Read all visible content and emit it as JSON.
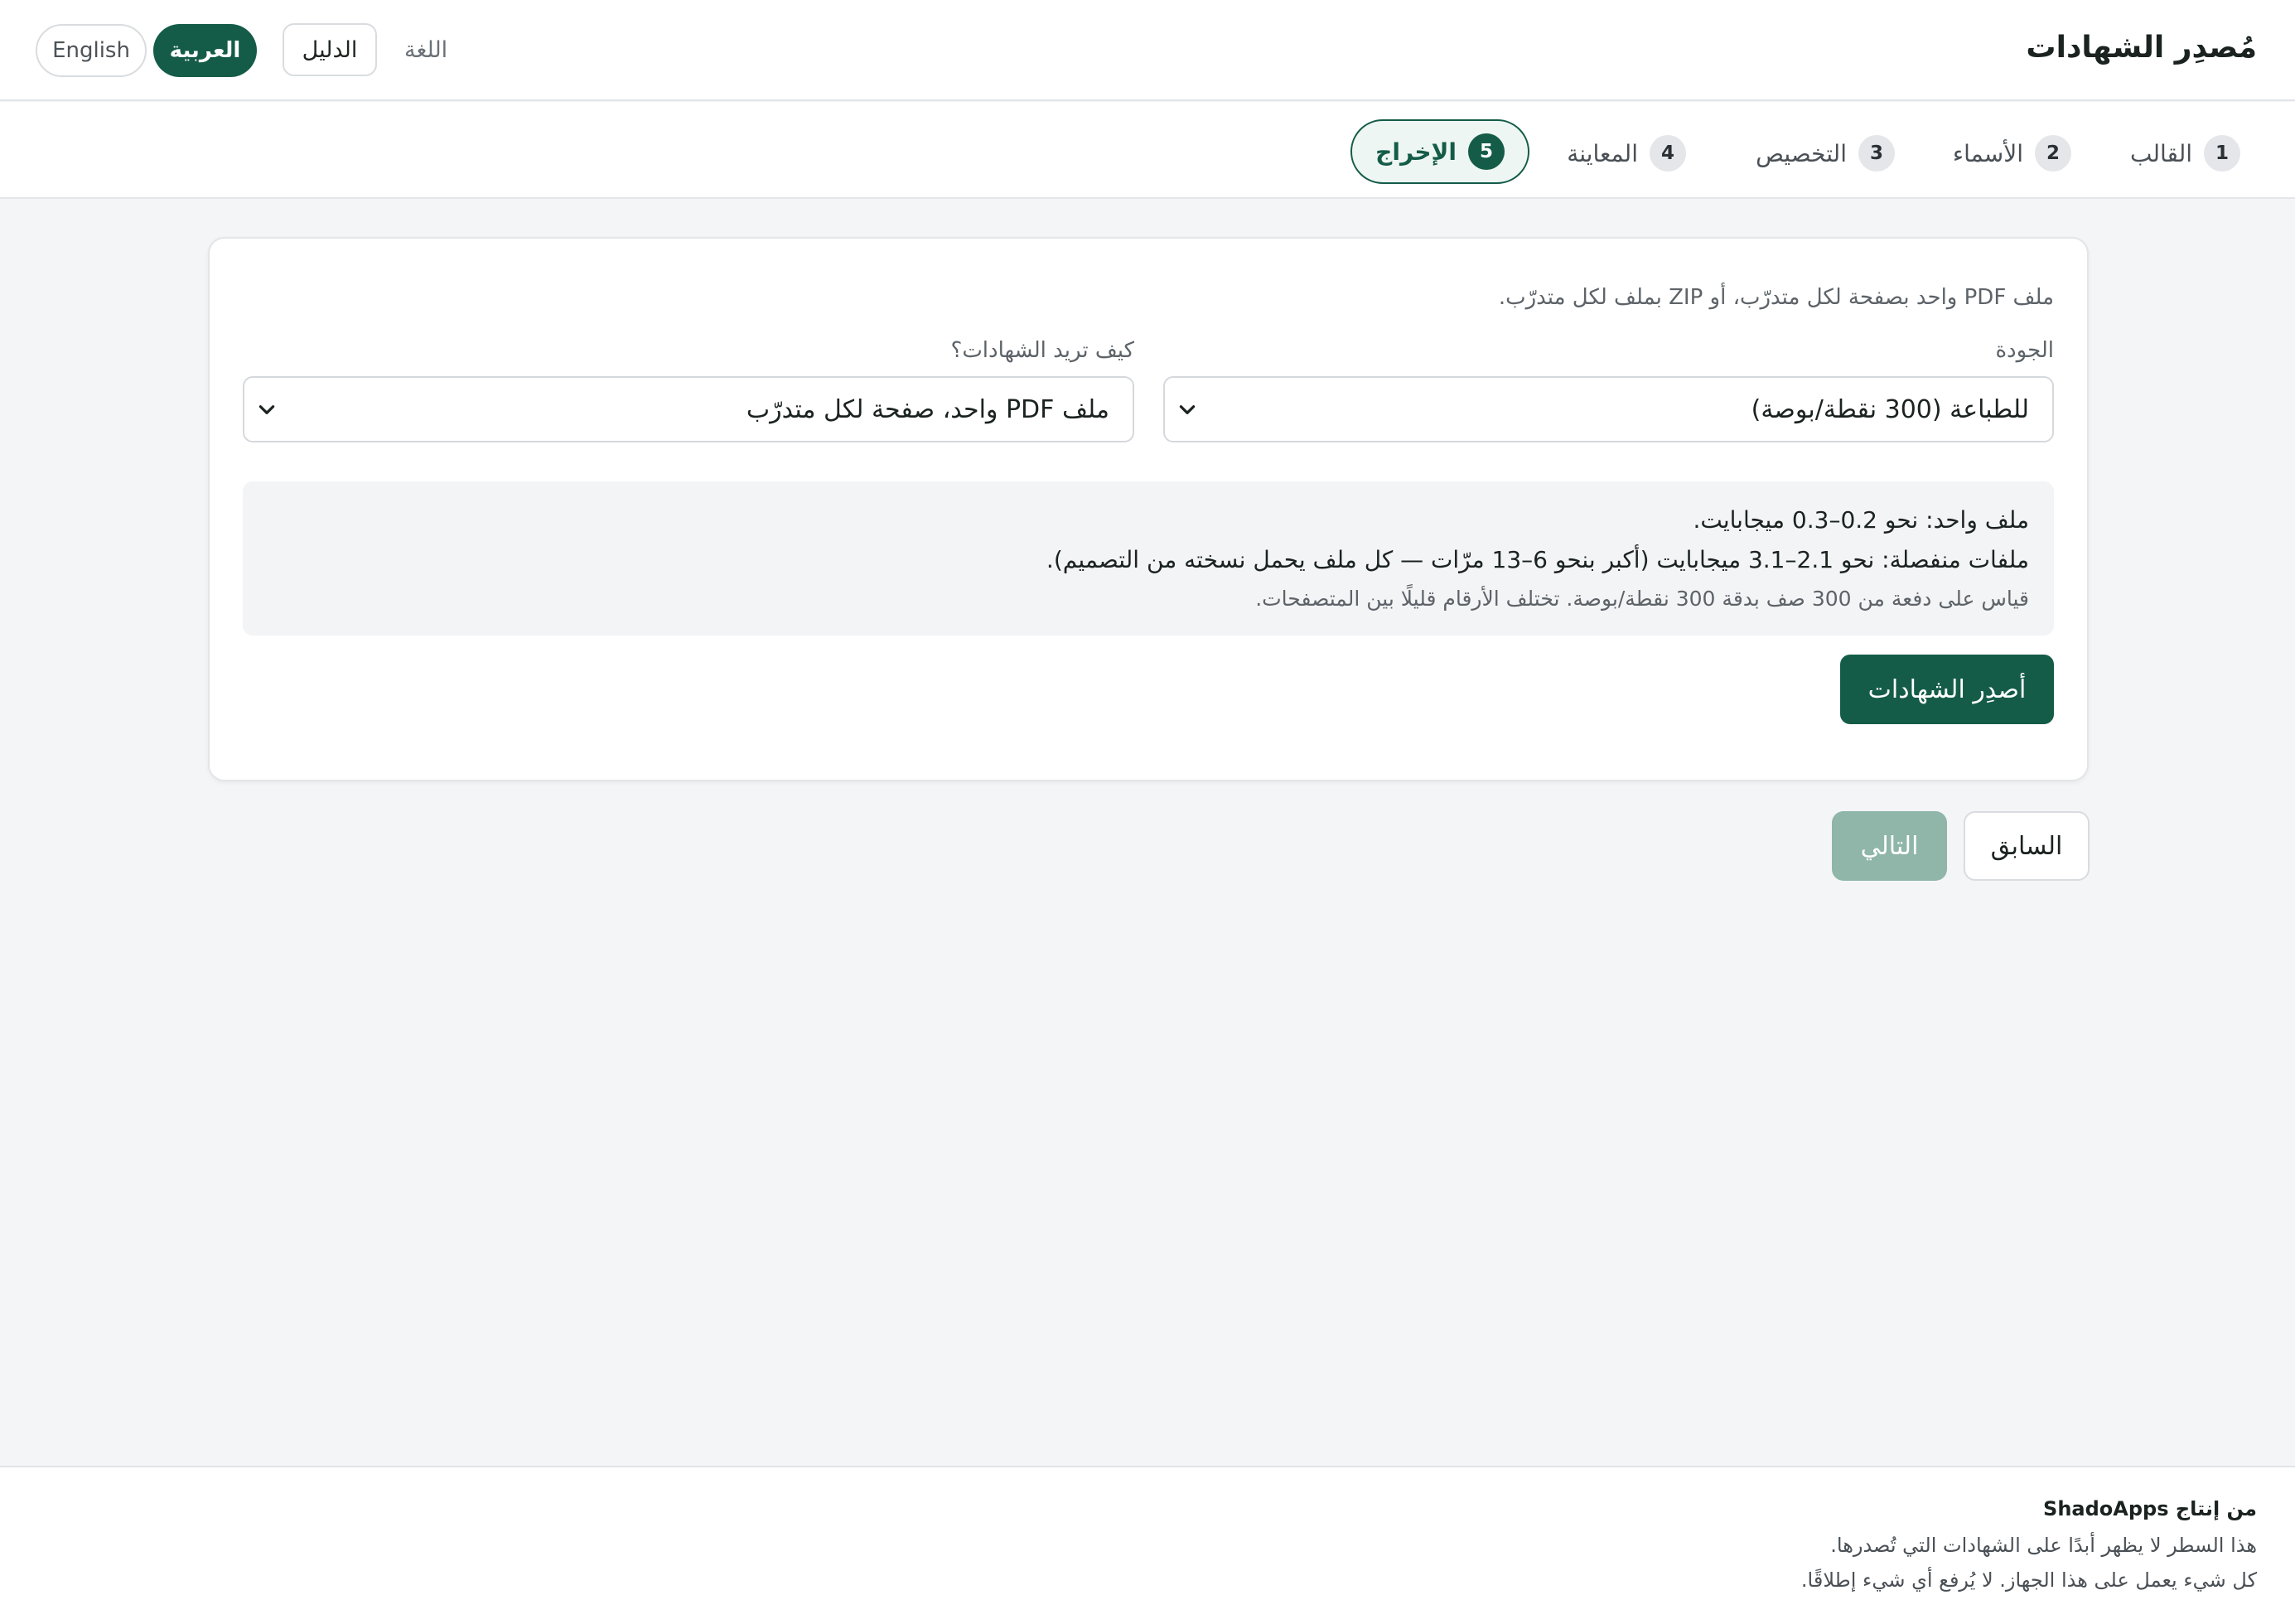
{
  "header": {
    "title": "مُصدِر الشهادات",
    "language_label": "اللغة",
    "guide_label": "الدليل",
    "lang_arabic": "العربية",
    "lang_english": "English"
  },
  "steps": [
    {
      "num": "1",
      "label": "القالب"
    },
    {
      "num": "2",
      "label": "الأسماء"
    },
    {
      "num": "3",
      "label": "التخصيص"
    },
    {
      "num": "4",
      "label": "المعاينة"
    },
    {
      "num": "5",
      "label": "الإخراج",
      "active": true
    }
  ],
  "card": {
    "description": "ملف PDF واحد بصفحة لكل متدرّب، أو ZIP بملف لكل متدرّب.",
    "quality_label": "الجودة",
    "quality_value": "للطباعة (300 نقطة/بوصة)",
    "format_label": "كيف تريد الشهادات؟",
    "format_value": "ملف PDF واحد، صفحة لكل متدرّب",
    "info_single": "ملف واحد: نحو 0.2–0.3 ميجابايت.",
    "info_separate": "ملفات منفصلة: نحو 2.1–3.1 ميجابايت (أكبر بنحو 6–13 مرّات — كل ملف يحمل نسخته من التصميم).",
    "info_note": "قياس على دفعة من 300 صف بدقة 300 نقطة/بوصة. تختلف الأرقام قليلًا بين المتصفحات.",
    "issue_button": "أصدِر الشهادات"
  },
  "nav": {
    "prev_label": "السابق",
    "next_label": "التالي"
  },
  "footer": {
    "credit": "من إنتاج ShadoApps",
    "line_2": "هذا السطر لا يظهر أبدًا على الشهادات التي تُصدرها.",
    "line_3": "كل شيء يعمل على هذا الجهاز. لا يُرفع أي شيء إطلاقًا."
  },
  "colors": {
    "accent": "#145c48",
    "accent_disabled": "#8fb6a8",
    "background": "#f4f5f7"
  },
  "icons": {
    "select_arrow": "chevron-down-icon"
  }
}
